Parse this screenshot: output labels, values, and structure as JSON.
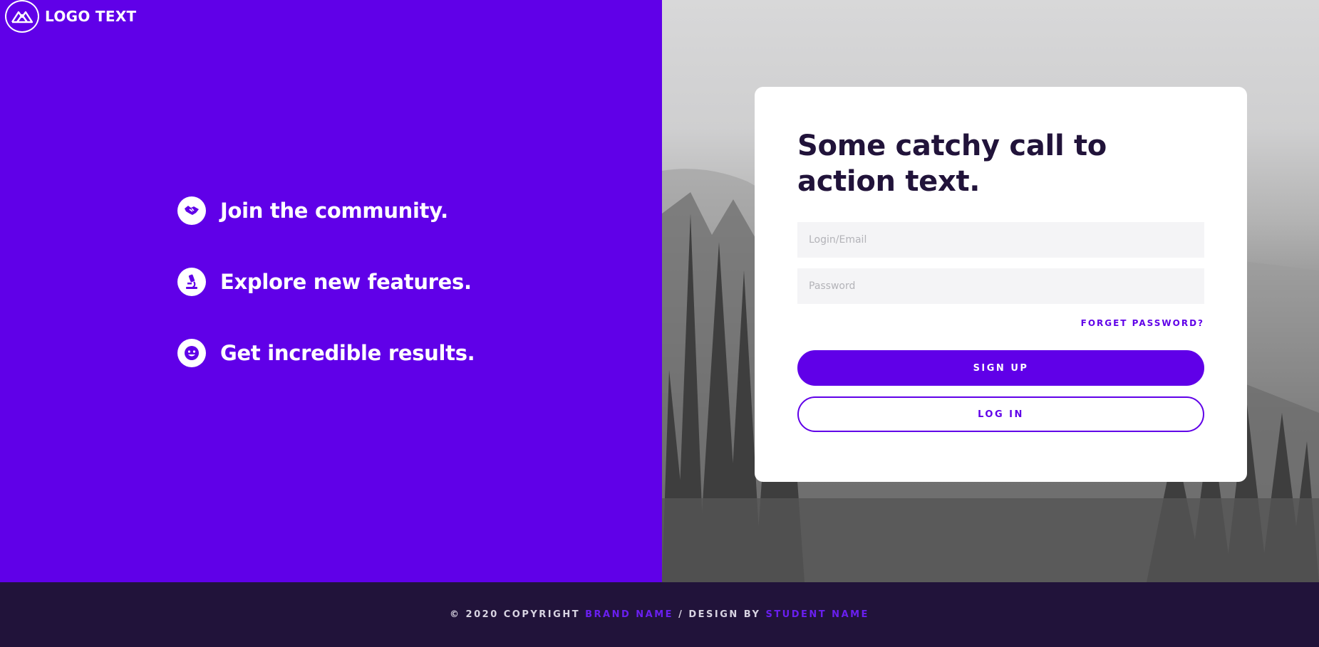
{
  "brand": {
    "logo_text": "LOGO TEXT",
    "logo_icon": "mountain-icon"
  },
  "features": [
    {
      "icon": "handshake-icon",
      "text": "Join the community."
    },
    {
      "icon": "microscope-icon",
      "text": "Explore new features."
    },
    {
      "icon": "smile-icon",
      "text": "Get incredible results."
    }
  ],
  "form": {
    "title": "Some catchy call to action text.",
    "login_placeholder": "Login/Email",
    "password_placeholder": "Password",
    "forgot_label": "FORGET PASSWORD?",
    "signup_label": "SIGN UP",
    "login_label": "LOG IN"
  },
  "footer": {
    "copyright": "© 2020 COPYRIGHT",
    "brand_name": "BRAND NAME",
    "separator": "/ DESIGN BY",
    "student_name": "STUDENT NAME"
  },
  "colors": {
    "primary": "#6000e8",
    "dark": "#21133a",
    "white": "#ffffff"
  }
}
